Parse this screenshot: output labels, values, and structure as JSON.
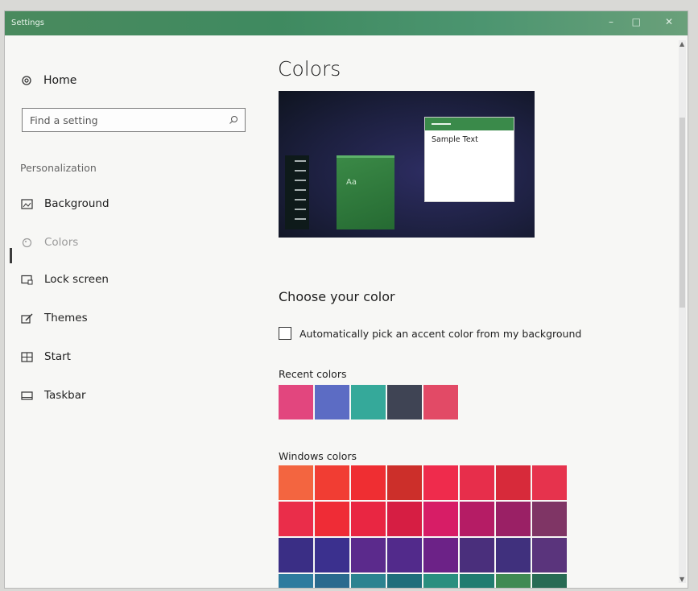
{
  "window": {
    "title": "Settings",
    "controls": [
      "–",
      "□",
      "✕"
    ]
  },
  "sidebar": {
    "home_label": "Home",
    "search_placeholder": "Find a setting",
    "section_title": "Personalization",
    "items": [
      {
        "label": "Background",
        "icon": "picture-icon"
      },
      {
        "label": "Colors",
        "icon": "palette-icon",
        "selected": true
      },
      {
        "label": "Lock screen",
        "icon": "lock-screen-icon"
      },
      {
        "label": "Themes",
        "icon": "brush-icon"
      },
      {
        "label": "Start",
        "icon": "start-icon"
      },
      {
        "label": "Taskbar",
        "icon": "taskbar-icon"
      }
    ]
  },
  "main": {
    "title": "Colors",
    "preview": {
      "sample_text": "Sample Text",
      "tile_text": "Aa"
    },
    "choose_heading": "Choose your color",
    "auto_pick": {
      "label": "Automatically pick an accent color from my background",
      "checked": false
    },
    "recent_label": "Recent colors",
    "recent_colors": [
      "#e2467e",
      "#5c6cc4",
      "#35a99a",
      "#3f4454",
      "#e24a66"
    ],
    "windows_label": "Windows colors",
    "windows_colors": [
      [
        "#f36540",
        "#f13d33",
        "#ef2e32",
        "#cc2f2a",
        "#ef2b4c",
        "#e72e4b",
        "#d72a3a",
        "#e6334d"
      ],
      [
        "#ea2d4a",
        "#ef2c36",
        "#e92642",
        "#d61e43",
        "#d71d66",
        "#b51c65",
        "#9a2065",
        "#7f3565"
      ],
      [
        "#3a2e85",
        "#3b308e",
        "#5b2a8c",
        "#522a8b",
        "#6c2287",
        "#4a2f7c",
        "#40307d",
        "#5a347c"
      ],
      [
        "#2e7b9e",
        "#2a6a8e",
        "#2c8390",
        "#1f6e7b",
        "#2a8f7f",
        "#217c70",
        "#3f8a52",
        "#286b54"
      ]
    ]
  }
}
